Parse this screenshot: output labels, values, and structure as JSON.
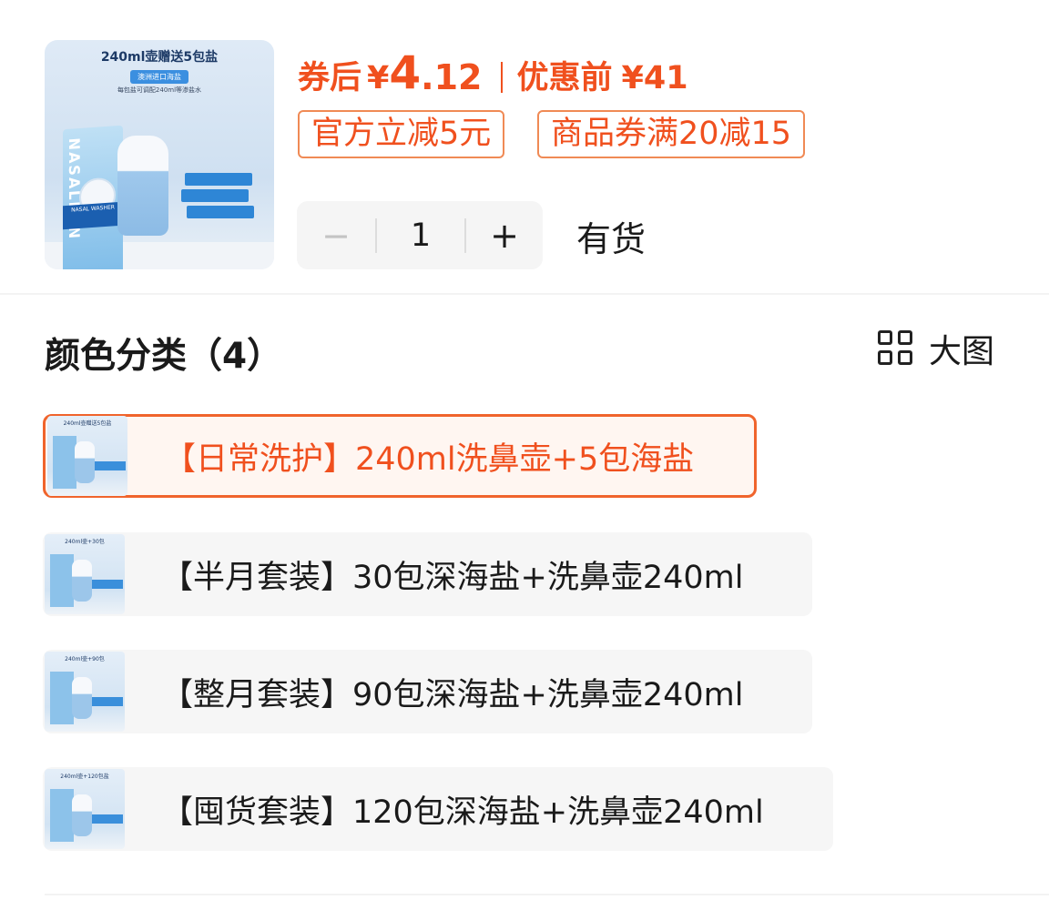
{
  "product": {
    "thumbnail": {
      "title": "240ml壶赠送5包盐",
      "tag": "澳洲进口海盐",
      "note": "每包盐可调配240ml等渗盐水",
      "brand_vertical": "NASALEAN",
      "box_label": "NASAL WASHER",
      "icon": "product-image"
    },
    "price": {
      "after_coupon_label": "券后",
      "currency": "¥",
      "after_coupon_int": "4",
      "after_coupon_dec": ".12",
      "before_label": "优惠前",
      "before_price": "¥41"
    },
    "coupons": [
      "官方立减5元",
      "商品券满20减15"
    ],
    "quantity": {
      "minus": "−",
      "value": "1",
      "plus": "+"
    },
    "stock_status": "有货"
  },
  "options_section": {
    "title": "颜色分类（4）",
    "view_toggle_label": "大图",
    "view_toggle_icon": "grid-icon",
    "items": [
      {
        "label": "【日常洗护】240ml洗鼻壶+5包海盐",
        "thumb_title": "240ml壶赠送5包盐",
        "selected": true
      },
      {
        "label": "【半月套装】30包深海盐+洗鼻壶240ml",
        "thumb_title": "240ml壶+30包",
        "selected": false
      },
      {
        "label": "【整月套装】90包深海盐+洗鼻壶240ml",
        "thumb_title": "240ml壶+90包",
        "selected": false
      },
      {
        "label": "【囤货套装】120包深海盐+洗鼻壶240ml",
        "thumb_title": "240ml壶+120包盐",
        "selected": false
      }
    ]
  },
  "colors": {
    "accent": "#f0501e",
    "accent_border": "#f08a55",
    "selected_bg": "#fff6f1",
    "option_bg": "#f6f6f6"
  }
}
